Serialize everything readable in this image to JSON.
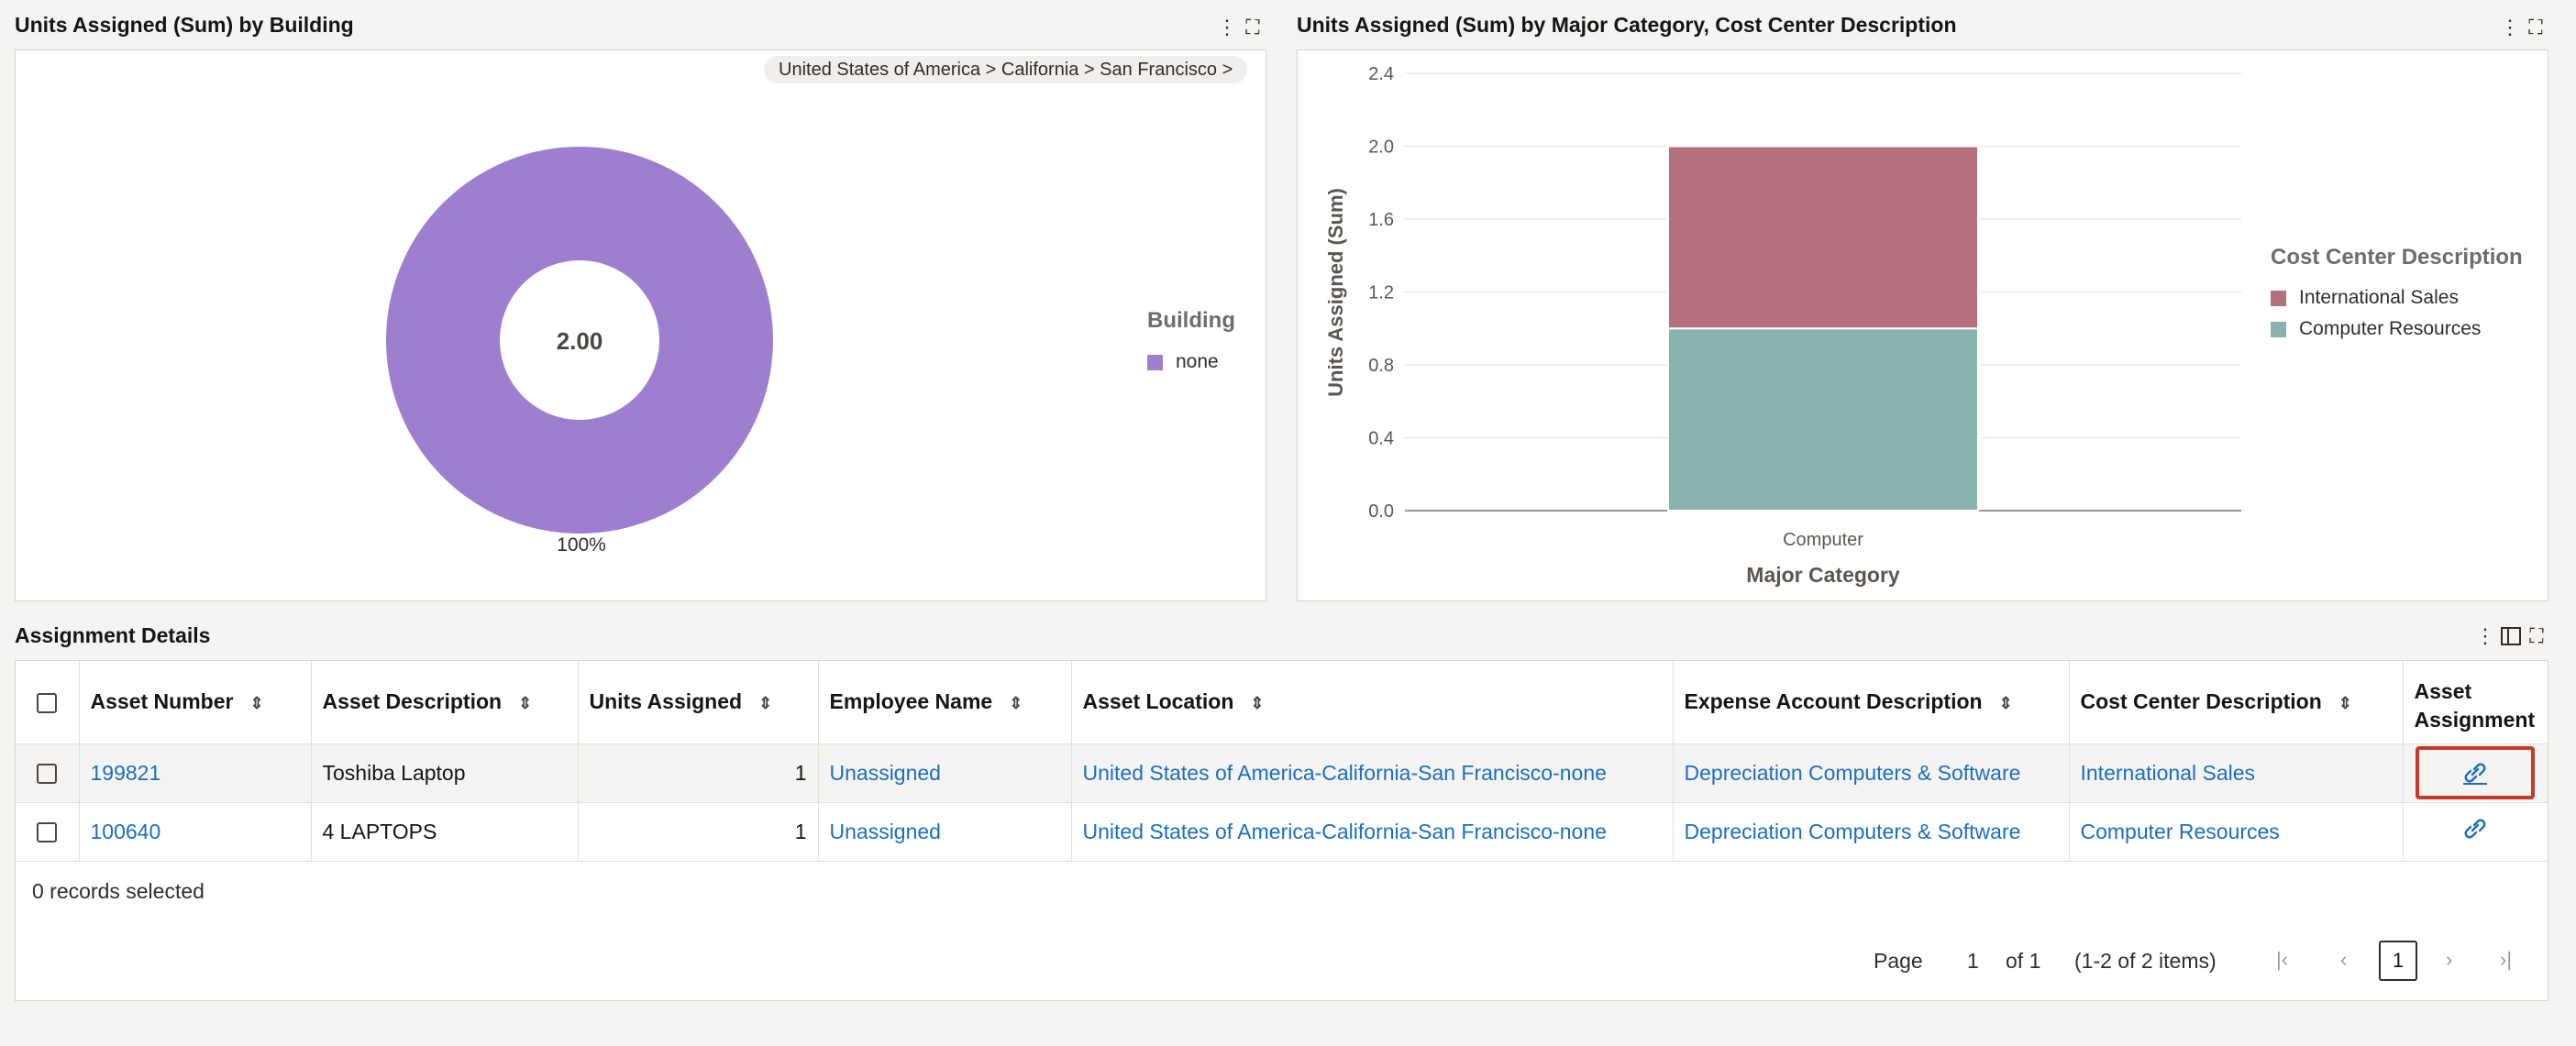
{
  "donut_panel": {
    "title": "Units Assigned (Sum) by Building",
    "breadcrumb": "United States of America > California > San Francisco >",
    "center_value": "2.00",
    "slice_label": "100%",
    "legend_title": "Building",
    "legend_item": "none",
    "slice_color": "#9e7fcf"
  },
  "bar_panel": {
    "title": "Units Assigned (Sum) by Major Category, Cost Center Description",
    "legend_title": "Cost Center Description"
  },
  "chart_data": [
    {
      "type": "pie",
      "title": "Units Assigned (Sum) by Building",
      "series": [
        {
          "name": "none",
          "values": [
            2.0
          ]
        }
      ],
      "labels": [
        "none"
      ],
      "center_label": "2.00",
      "slice_label": "100%",
      "legend_title": "Building",
      "legend_position": "right"
    },
    {
      "type": "bar",
      "stacked": true,
      "title": "Units Assigned (Sum) by Major Category, Cost Center Description",
      "categories": [
        "Computer"
      ],
      "series": [
        {
          "name": "International Sales",
          "values": [
            1.0
          ],
          "color": "#b5707e"
        },
        {
          "name": "Computer Resources",
          "values": [
            1.0
          ],
          "color": "#8ab3b0"
        }
      ],
      "xlabel": "Major Category",
      "ylabel": "Units Assigned (Sum)",
      "ylim": [
        0,
        2.4
      ],
      "yticks": [
        "0.0",
        "0.4",
        "0.8",
        "1.2",
        "1.6",
        "2.0",
        "2.4"
      ],
      "grid": true,
      "legend_title": "Cost Center Description",
      "legend_position": "right"
    }
  ],
  "table": {
    "title": "Assignment Details",
    "headers": {
      "asset_number": "Asset Number",
      "asset_description": "Asset Description",
      "units_assigned": "Units Assigned",
      "employee_name": "Employee Name",
      "asset_location": "Asset Location",
      "expense_account": "Expense Account Description",
      "cost_center": "Cost Center Description",
      "asset_assignment_1": "Asset",
      "asset_assignment_2": "Assignment"
    },
    "rows": [
      {
        "asset_number": "199821",
        "asset_description": "Toshiba Laptop",
        "units_assigned": "1",
        "employee_name": "Unassigned",
        "asset_location": "United States of America-California-San Francisco-none",
        "expense_account": "Depreciation Computers & Software",
        "cost_center": "International Sales"
      },
      {
        "asset_number": "100640",
        "asset_description": "4 LAPTOPS",
        "units_assigned": "1",
        "employee_name": "Unassigned",
        "asset_location": "United States of America-California-San Francisco-none",
        "expense_account": "Depreciation Computers & Software",
        "cost_center": "Computer Resources"
      }
    ],
    "records_selected": "0 records selected",
    "pagination": {
      "page_label": "Page",
      "page_value": "1",
      "of_label": "of 1",
      "items_label": "(1-2 of 2 items)",
      "current_page": "1"
    },
    "highlight_color": "#c7392b",
    "link_color": "#1a6fbf"
  }
}
